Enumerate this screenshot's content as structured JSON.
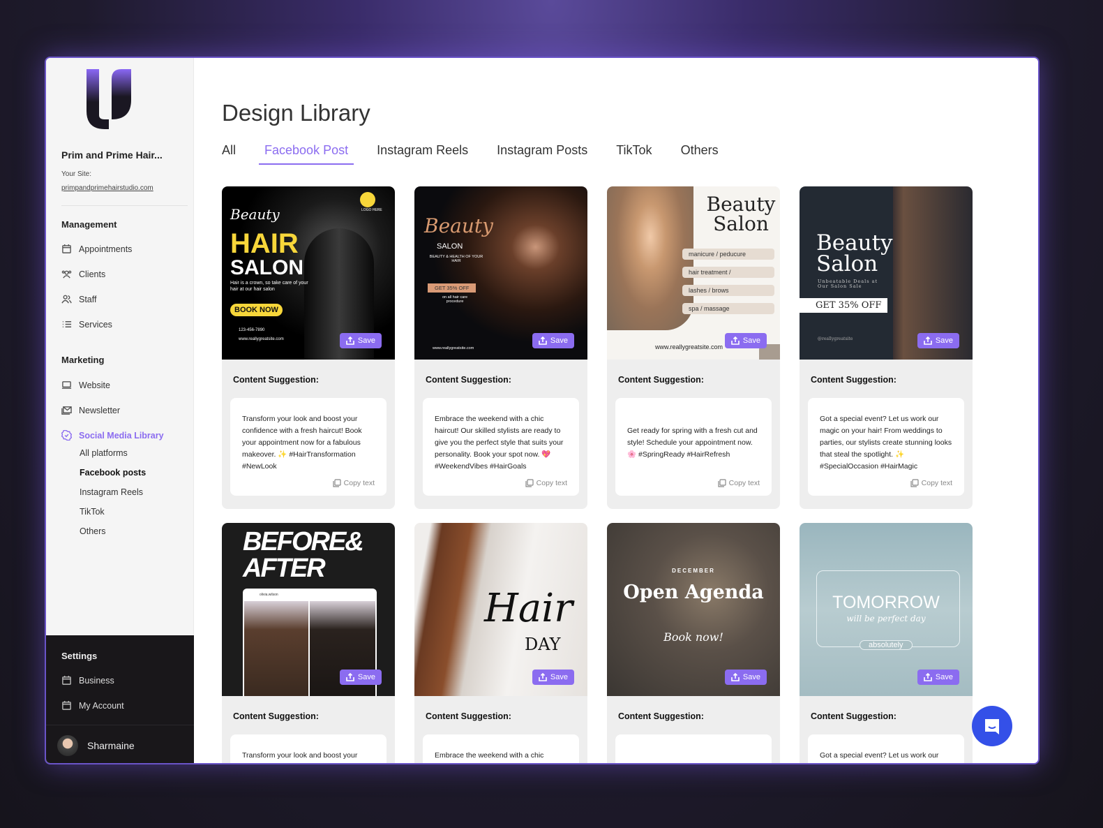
{
  "sidebar": {
    "business_name": "Prim and Prime Hair...",
    "site_label": "Your Site:",
    "site_url": "primpandprimehairstudio.com",
    "management_label": "Management",
    "management": [
      "Appointments",
      "Clients",
      "Staff",
      "Services"
    ],
    "marketing_label": "Marketing",
    "marketing": [
      "Website",
      "Newsletter",
      "Social Media Library"
    ],
    "social_sub": [
      "All platforms",
      "Facebook posts",
      "Instagram Reels",
      "TikTok",
      "Others"
    ],
    "settings_label": "Settings",
    "settings": [
      "Business",
      "My Account"
    ],
    "user_name": "Sharmaine"
  },
  "main": {
    "title": "Design Library",
    "tabs": [
      "All",
      "Facebook Post",
      "Instagram Reels",
      "Instagram Posts",
      "TikTok",
      "Others"
    ],
    "active_tab": "Facebook Post",
    "save_label": "Save",
    "suggestion_label": "Content Suggestion:",
    "copy_label": "Copy text",
    "suggestions": [
      "Transform your look and boost your confidence with a fresh haircut! Book your appointment now for a fabulous makeover. ✨ #HairTransformation #NewLook",
      "Embrace the weekend with a chic haircut! Our skilled stylists are ready to give you the perfect style that suits your personality. Book your spot now. 💖 #WeekendVibes #HairGoals",
      "Get ready for spring with a fresh cut and style!  Schedule your appointment now. 🌸 #SpringReady #HairRefresh",
      "Got a special event? Let us work our magic on your hair! From weddings to parties, our stylists create stunning looks that steal the spotlight. ✨ #SpecialOccasion #HairMagic"
    ],
    "designs": {
      "d1": {
        "script": "Beauty",
        "hair": "HAIR",
        "salon": "SALON",
        "tag": "Hair is a crown, so take care of your hair at our hair salon",
        "cta": "BOOK NOW",
        "phone": "123-456-7890",
        "web": "www.reallygreatsite.com",
        "logo": "LOGO HERE"
      },
      "d2": {
        "script": "Beauty",
        "salon": "SALON",
        "sub": "BEAUTY & HEALTH OF YOUR HAIR",
        "offer": "GET 35% OFF",
        "note": "on all hair care procedure",
        "web": "www.reallygreatsite.com"
      },
      "d3": {
        "title1": "Beauty",
        "title2": "Salon",
        "items": [
          "manicure / peducure",
          "hair treatment /",
          "lashes / brows",
          "spa / massage"
        ],
        "web": "www.reallygreatsite.com"
      },
      "d4": {
        "title1": "Beauty",
        "title2": "Salon",
        "sub": "Unbeatable Deals at Our Salon Sale",
        "offer": "GET 35% OFF",
        "handle": "@reallygreatsite"
      },
      "d5": {
        "title": "BEFORE& AFTER",
        "user": "olivia.wilson"
      },
      "d6": {
        "script": "Hair",
        "day": "DAY"
      },
      "d7": {
        "month": "DECEMBER",
        "title": "Open Agenda",
        "script": "Book now!"
      },
      "d8": {
        "title": "TOMORROW",
        "sub": "will be perfect day",
        "tag": "absolutely"
      }
    }
  },
  "colors": {
    "accent": "#8b6cf0",
    "chat": "#3450e8"
  }
}
